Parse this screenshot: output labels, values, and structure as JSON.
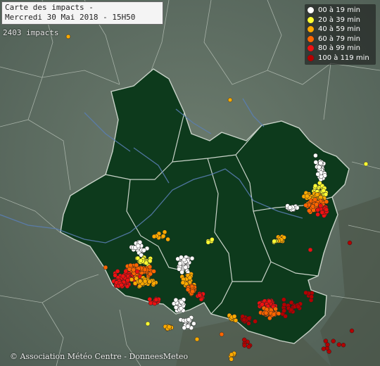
{
  "title": {
    "line1": "Carte des impacts -",
    "line2": "Mercredi 30 Mai 2018 - 15H50"
  },
  "impact_count": "2403 impacts",
  "legend": [
    {
      "label": "00 à 19 min",
      "color": "#ffffff"
    },
    {
      "label": "20 à 39 min",
      "color": "#ffff33"
    },
    {
      "label": "40 à 59 min",
      "color": "#ffaa00"
    },
    {
      "label": "60 à 79 min",
      "color": "#ff6600"
    },
    {
      "label": "80 à 99 min",
      "color": "#ee1111"
    },
    {
      "label": "100 à 119 min",
      "color": "#b30000"
    }
  ],
  "copyright": "© Association Météo Centre - DonneesMeteo",
  "colors": {
    "background_terrain": "#5f6f63",
    "region_fill": "#0d3a1c",
    "borders": "#cfd6cf",
    "rivers": "#5a7fb5"
  }
}
